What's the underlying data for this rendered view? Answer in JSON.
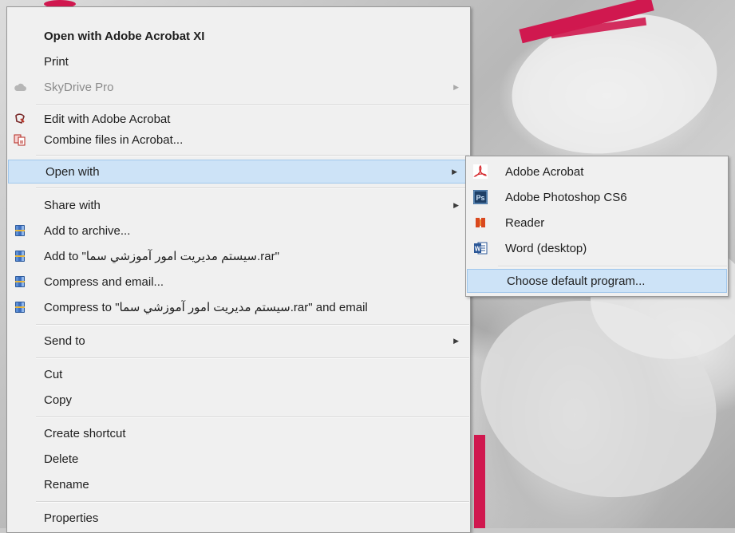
{
  "menu": {
    "items": [
      {
        "key": "open_acrobat",
        "label": "Open with Adobe Acrobat XI"
      },
      {
        "key": "print",
        "label": "Print"
      },
      {
        "key": "skydrive",
        "label": "SkyDrive Pro"
      },
      {
        "key": "edit_acrobat",
        "label": "Edit with Adobe Acrobat"
      },
      {
        "key": "combine",
        "label": "Combine files in Acrobat..."
      },
      {
        "key": "open_with",
        "label": "Open with"
      },
      {
        "key": "share_with",
        "label": "Share with"
      },
      {
        "key": "add_archive",
        "label": "Add to archive..."
      },
      {
        "key": "add_to_rar",
        "label": "Add to \"سيستم مديريت امور آموزشي سما.rar\""
      },
      {
        "key": "compress_email",
        "label": "Compress and email..."
      },
      {
        "key": "compress_to_rar_email",
        "label": "Compress to \"سيستم مديريت امور آموزشي سما.rar\" and email"
      },
      {
        "key": "send_to",
        "label": "Send to"
      },
      {
        "key": "cut",
        "label": "Cut"
      },
      {
        "key": "copy",
        "label": "Copy"
      },
      {
        "key": "create_shortcut",
        "label": "Create shortcut"
      },
      {
        "key": "delete",
        "label": "Delete"
      },
      {
        "key": "rename",
        "label": "Rename"
      },
      {
        "key": "properties",
        "label": "Properties"
      }
    ]
  },
  "submenu": {
    "items": [
      {
        "label": "Adobe Acrobat",
        "icon": "acrobat-icon"
      },
      {
        "label": "Adobe Photoshop CS6",
        "icon": "photoshop-icon"
      },
      {
        "label": "Reader",
        "icon": "reader-icon"
      },
      {
        "label": "Word (desktop)",
        "icon": "word-icon"
      },
      {
        "label": "Choose default program..."
      }
    ]
  },
  "icons": {
    "skydrive": "cloud-icon",
    "edit_acrobat": "acrobat-edit-icon",
    "combine": "acrobat-combine-icon",
    "winrar": "winrar-icon"
  },
  "colors": {
    "menu_bg": "#f0f0f0",
    "hover_bg": "#cde3f7",
    "hover_border": "#a0c7ec",
    "accent_pink": "#d0184f"
  }
}
